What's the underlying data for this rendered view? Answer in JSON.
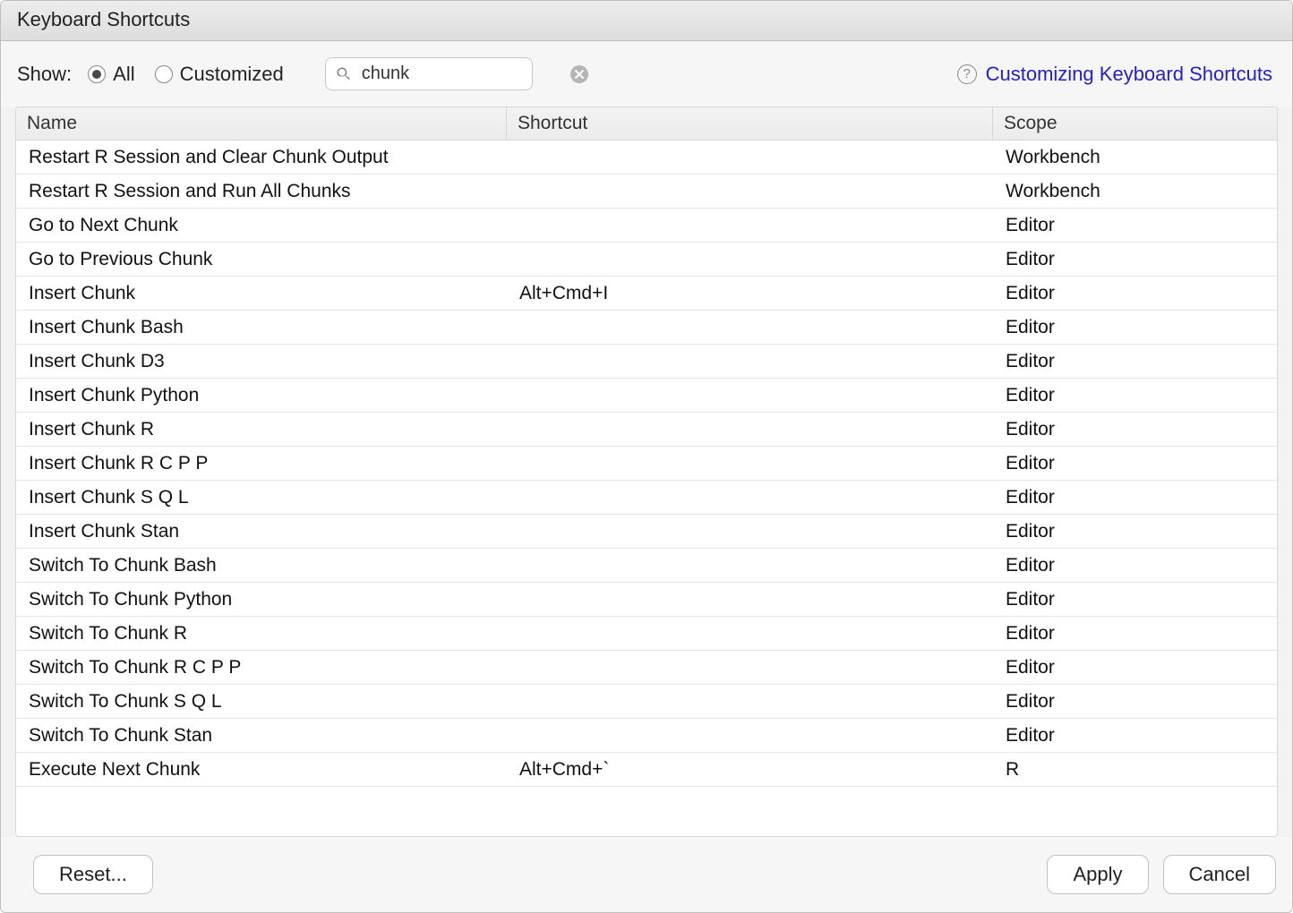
{
  "title": "Keyboard Shortcuts",
  "toolbar": {
    "show_label": "Show:",
    "radio_all": "All",
    "radio_customized": "Customized",
    "search_value": "chunk",
    "help_link": "Customizing Keyboard Shortcuts"
  },
  "columns": {
    "name": "Name",
    "shortcut": "Shortcut",
    "scope": "Scope"
  },
  "rows": [
    {
      "name": "Restart R Session and Clear Chunk Output",
      "shortcut": "",
      "scope": "Workbench"
    },
    {
      "name": "Restart R Session and Run All Chunks",
      "shortcut": "",
      "scope": "Workbench"
    },
    {
      "name": "Go to Next Chunk",
      "shortcut": "",
      "scope": "Editor"
    },
    {
      "name": "Go to Previous Chunk",
      "shortcut": "",
      "scope": "Editor"
    },
    {
      "name": "Insert Chunk",
      "shortcut": "Alt+Cmd+I",
      "scope": "Editor"
    },
    {
      "name": "Insert Chunk Bash",
      "shortcut": "",
      "scope": "Editor"
    },
    {
      "name": "Insert Chunk D3",
      "shortcut": "",
      "scope": "Editor"
    },
    {
      "name": "Insert Chunk Python",
      "shortcut": "",
      "scope": "Editor"
    },
    {
      "name": "Insert Chunk R",
      "shortcut": "",
      "scope": "Editor"
    },
    {
      "name": "Insert Chunk R C P P",
      "shortcut": "",
      "scope": "Editor"
    },
    {
      "name": "Insert Chunk S Q L",
      "shortcut": "",
      "scope": "Editor"
    },
    {
      "name": "Insert Chunk Stan",
      "shortcut": "",
      "scope": "Editor"
    },
    {
      "name": "Switch To Chunk Bash",
      "shortcut": "",
      "scope": "Editor"
    },
    {
      "name": "Switch To Chunk Python",
      "shortcut": "",
      "scope": "Editor"
    },
    {
      "name": "Switch To Chunk R",
      "shortcut": "",
      "scope": "Editor"
    },
    {
      "name": "Switch To Chunk R C P P",
      "shortcut": "",
      "scope": "Editor"
    },
    {
      "name": "Switch To Chunk S Q L",
      "shortcut": "",
      "scope": "Editor"
    },
    {
      "name": "Switch To Chunk Stan",
      "shortcut": "",
      "scope": "Editor"
    },
    {
      "name": "Execute Next Chunk",
      "shortcut": "Alt+Cmd+`",
      "scope": "R"
    }
  ],
  "footer": {
    "reset": "Reset...",
    "apply": "Apply",
    "cancel": "Cancel"
  }
}
